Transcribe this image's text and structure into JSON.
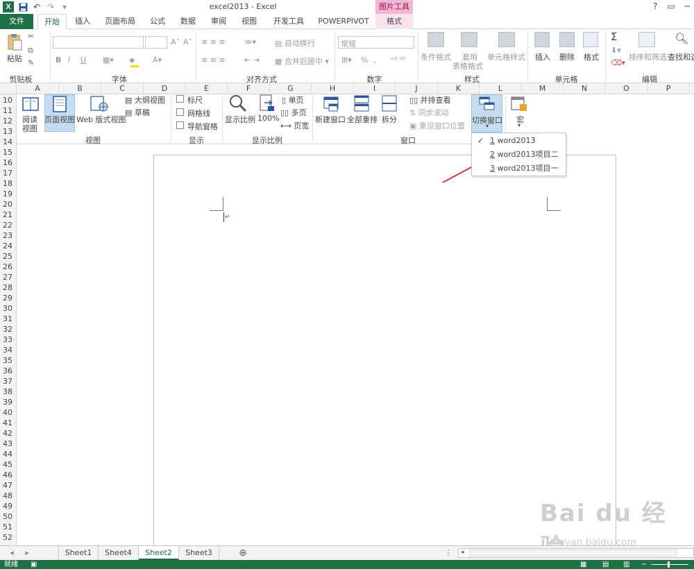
{
  "window": {
    "title": "excel2013 - Excel",
    "context_header": "图片工具",
    "help": "?",
    "quick_access": [
      "save-icon",
      "undo-icon",
      "redo-icon",
      "customize-icon"
    ]
  },
  "tabs": [
    {
      "label": "文件"
    },
    {
      "label": "开始"
    },
    {
      "label": "插入"
    },
    {
      "label": "页面布局"
    },
    {
      "label": "公式"
    },
    {
      "label": "数据"
    },
    {
      "label": "审阅"
    },
    {
      "label": "视图"
    },
    {
      "label": "开发工具"
    },
    {
      "label": "POWERPIVOT"
    },
    {
      "label": "格式"
    }
  ],
  "home_ribbon": {
    "clipboard": {
      "paste": "粘贴",
      "group": "剪贴板"
    },
    "font": {
      "group": "字体",
      "bold": "B",
      "italic": "I",
      "underline": "U"
    },
    "alignment": {
      "wrap": "自动换行",
      "merge": "合并后居中",
      "group": "对齐方式"
    },
    "number": {
      "format": "常规",
      "percent": "%",
      "comma": ",",
      "group": "数字"
    },
    "styles": {
      "cond": "条件格式",
      "table_1": "套用",
      "table_2": "表格格式",
      "cell_style": "单元格样式",
      "group": "样式"
    },
    "cells": {
      "insert": "插入",
      "delete": "删除",
      "format": "格式",
      "group": "单元格"
    },
    "editing": {
      "sort": "排序和筛选",
      "find": "查找和选",
      "group": "编辑",
      "sum": "Σ"
    }
  },
  "columns": [
    "A",
    "B",
    "C",
    "D",
    "E",
    "F",
    "G",
    "H",
    "I",
    "J",
    "K",
    "L",
    "M",
    "N",
    "O",
    "P"
  ],
  "rows": [
    "10",
    "11",
    "12",
    "13",
    "14",
    "15",
    "16",
    "17",
    "18",
    "19",
    "20",
    "21",
    "22",
    "23",
    "24",
    "25",
    "26",
    "27",
    "28",
    "29",
    "30",
    "31",
    "32",
    "33",
    "34",
    "35",
    "36",
    "37",
    "38",
    "39",
    "40",
    "41",
    "42",
    "43",
    "44",
    "45",
    "46",
    "47",
    "48",
    "49",
    "50",
    "51",
    "52"
  ],
  "view_ribbon": {
    "views": {
      "read_1": "阅读",
      "read_2": "视图",
      "page_view": "页面视图",
      "web": "Web 版式视图",
      "outline": "大纲视图",
      "draft": "草稿",
      "group": "视图"
    },
    "show": {
      "ruler": "标尺",
      "gridlines": "网格线",
      "nav": "导航窗格",
      "group": "显示"
    },
    "zoom": {
      "zoom": "显示比例",
      "pct": "100%",
      "one_page": "单页",
      "multi_page": "多页",
      "page_width": "页宽",
      "group": "显示比例"
    },
    "window": {
      "new": "新建窗口",
      "arrange": "全部重排",
      "split": "拆分",
      "side": "并排查看",
      "sync": "同步滚动",
      "reset": "重设窗口位置",
      "switch": "切换窗口",
      "group": "窗口"
    },
    "macro": {
      "label": "宏"
    }
  },
  "switch_menu": {
    "items": [
      {
        "accel": "1",
        "label": "word2013",
        "checked": "✓"
      },
      {
        "accel": "2",
        "label": "word2013项目二"
      },
      {
        "accel": "3",
        "label": "word2013项目一"
      }
    ]
  },
  "sheet_tabs": [
    "Sheet1",
    "Sheet4",
    "Sheet2",
    "Sheet3"
  ],
  "status": {
    "ready": "就绪"
  },
  "watermark": {
    "brand": "Bai du 经验",
    "url": "jingyan.baidu.com"
  }
}
